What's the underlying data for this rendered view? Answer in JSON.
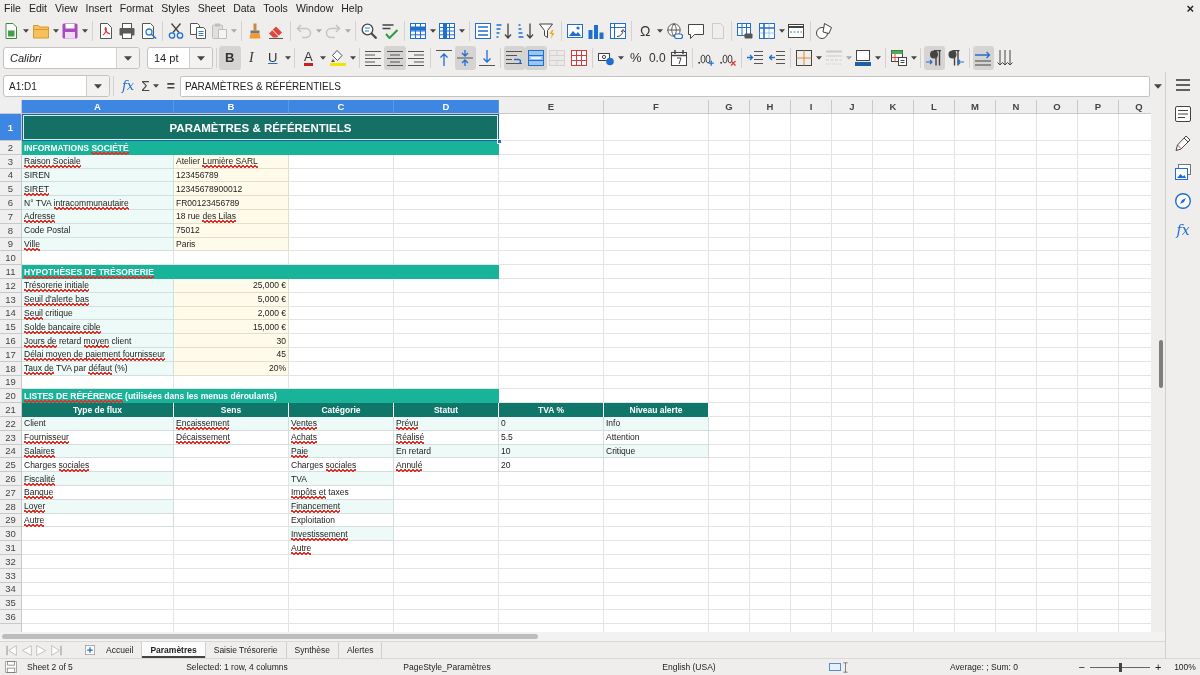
{
  "menu_bar": {
    "items": [
      "File",
      "Edit",
      "View",
      "Insert",
      "Format",
      "Styles",
      "Sheet",
      "Data",
      "Tools",
      "Window",
      "Help"
    ],
    "close_document": "×"
  },
  "standard_toolbar": [
    [
      {
        "dropdown": true,
        "disabled": false
      },
      {
        "dropdown": true,
        "disabled": false
      },
      {
        "dropdown": true,
        "disabled": false
      }
    ],
    [
      {
        "dropdown": false,
        "disabled": false
      },
      {
        "dropdown": false,
        "disabled": false
      },
      {
        "dropdown": false,
        "disabled": false
      }
    ],
    [
      {
        "dropdown": false,
        "disabled": false
      },
      {
        "dropdown": false,
        "disabled": false
      },
      {
        "dropdown": true,
        "disabled": true
      }
    ],
    [
      {
        "dropdown": false,
        "disabled": false
      },
      {
        "dropdown": false,
        "disabled": false
      }
    ],
    [
      {
        "dropdown": true,
        "disabled": true
      },
      {
        "dropdown": true,
        "disabled": true
      }
    ],
    [
      {
        "dropdown": false,
        "disabled": false
      },
      {
        "dropdown": false,
        "disabled": false
      }
    ],
    [
      {
        "dropdown": true,
        "disabled": false
      },
      {
        "dropdown": true,
        "disabled": false
      }
    ],
    [
      {
        "dropdown": false,
        "disabled": false
      },
      {
        "dropdown": false,
        "disabled": false
      },
      {
        "dropdown": false,
        "disabled": false
      },
      {
        "dropdown": false,
        "disabled": false
      }
    ],
    [
      {
        "dropdown": false,
        "disabled": false
      },
      {
        "dropdown": false,
        "disabled": false
      },
      {
        "dropdown": false,
        "disabled": false
      }
    ],
    [
      {
        "label": "Ω",
        "dropdown": true,
        "disabled": false
      },
      {
        "dropdown": false,
        "disabled": false
      },
      {
        "dropdown": false,
        "disabled": false
      },
      {
        "dropdown": false,
        "disabled": true
      }
    ],
    [
      {
        "dropdown": false,
        "disabled": false
      },
      {
        "dropdown": true,
        "disabled": false
      },
      {
        "dropdown": false,
        "disabled": false
      }
    ],
    [
      {
        "dropdown": false,
        "disabled": false
      }
    ]
  ],
  "formatting_toolbar": {
    "font_name": "Calibri",
    "font_size": "14 pt",
    "groups": [
      [
        {
          "label": "B",
          "on": true,
          "dropdown": false,
          "disabled": false
        },
        {
          "label": "I",
          "on": false,
          "dropdown": false,
          "disabled": false
        },
        {
          "label": "U",
          "on": false,
          "dropdown": true,
          "disabled": false
        }
      ],
      [
        {
          "label": "A",
          "on": false,
          "dropdown": true,
          "disabled": false
        },
        {
          "on": false,
          "dropdown": true,
          "disabled": false
        }
      ],
      [
        {
          "on": false,
          "dropdown": false,
          "disabled": false
        },
        {
          "on": true,
          "dropdown": false,
          "disabled": false
        },
        {
          "on": false,
          "dropdown": false,
          "disabled": false
        }
      ],
      [
        {
          "on": false,
          "dropdown": false,
          "disabled": false
        },
        {
          "on": true,
          "dropdown": false,
          "disabled": false
        },
        {
          "on": false,
          "dropdown": false,
          "disabled": false
        }
      ],
      [
        {
          "on": true,
          "dropdown": false,
          "disabled": false
        },
        {
          "on": true,
          "dropdown": false,
          "disabled": false
        },
        {
          "on": false,
          "dropdown": false,
          "disabled": true
        },
        {
          "on": false,
          "dropdown": false,
          "disabled": false
        }
      ],
      [
        {
          "on": false,
          "dropdown": true,
          "disabled": false
        },
        {
          "label": "%",
          "on": false,
          "dropdown": false,
          "disabled": false
        },
        {
          "label": "0.0",
          "on": false,
          "dropdown": false,
          "disabled": false
        },
        {
          "on": false,
          "dropdown": false,
          "disabled": false
        }
      ],
      [
        {
          "on": false,
          "dropdown": false,
          "disabled": false
        },
        {
          "on": false,
          "dropdown": false,
          "disabled": false
        }
      ],
      [
        {
          "on": false,
          "dropdown": false,
          "disabled": false
        },
        {
          "on": false,
          "dropdown": false,
          "disabled": false
        }
      ],
      [
        {
          "on": false,
          "dropdown": true,
          "disabled": false
        },
        {
          "on": false,
          "dropdown": true,
          "disabled": true
        },
        {
          "on": false,
          "dropdown": true,
          "disabled": false
        }
      ],
      [
        {
          "on": false,
          "dropdown": true,
          "disabled": false
        }
      ],
      [
        {
          "on": true,
          "dropdown": false,
          "disabled": false
        },
        {
          "on": false,
          "dropdown": false,
          "disabled": false
        }
      ],
      [
        {
          "on": true,
          "dropdown": false,
          "disabled": false
        },
        {
          "on": false,
          "dropdown": false,
          "disabled": false
        }
      ]
    ]
  },
  "formula_bar": {
    "name_box": "A1:D1",
    "function_wizard": "fx",
    "sum": "Σ",
    "formula": "=",
    "content": "PARAMÈTRES & RÉFÉRENTIELS"
  },
  "sheet": {
    "column_headers": [
      {
        "label": "A",
        "selected": true
      },
      {
        "label": "B",
        "selected": true
      },
      {
        "label": "C",
        "selected": true
      },
      {
        "label": "D",
        "selected": true
      },
      {
        "label": "E",
        "selected": false
      },
      {
        "label": "F",
        "selected": false
      },
      {
        "label": "G",
        "selected": false
      },
      {
        "label": "H",
        "selected": false
      },
      {
        "label": "I",
        "selected": false
      },
      {
        "label": "J",
        "selected": false
      },
      {
        "label": "K",
        "selected": false
      },
      {
        "label": "L",
        "selected": false
      },
      {
        "label": "M",
        "selected": false
      },
      {
        "label": "N",
        "selected": false
      },
      {
        "label": "O",
        "selected": false
      },
      {
        "label": "P",
        "selected": false
      },
      {
        "label": "Q",
        "selected": false
      }
    ],
    "row_headers": [
      {
        "label": "1",
        "selected": true
      },
      {
        "label": "2",
        "selected": false
      },
      {
        "label": "3",
        "selected": false
      },
      {
        "label": "4",
        "selected": false
      },
      {
        "label": "5",
        "selected": false
      },
      {
        "label": "6",
        "selected": false
      },
      {
        "label": "7",
        "selected": false
      },
      {
        "label": "8",
        "selected": false
      },
      {
        "label": "9",
        "selected": false
      },
      {
        "label": "10",
        "selected": false
      },
      {
        "label": "11",
        "selected": false
      },
      {
        "label": "12",
        "selected": false
      },
      {
        "label": "13",
        "selected": false
      },
      {
        "label": "14",
        "selected": false
      },
      {
        "label": "15",
        "selected": false
      },
      {
        "label": "16",
        "selected": false
      },
      {
        "label": "17",
        "selected": false
      },
      {
        "label": "18",
        "selected": false
      },
      {
        "label": "19",
        "selected": false
      },
      {
        "label": "20",
        "selected": false
      },
      {
        "label": "21",
        "selected": false
      },
      {
        "label": "22",
        "selected": false
      },
      {
        "label": "23",
        "selected": false
      },
      {
        "label": "24",
        "selected": false
      },
      {
        "label": "25",
        "selected": false
      },
      {
        "label": "26",
        "selected": false
      },
      {
        "label": "27",
        "selected": false
      },
      {
        "label": "28",
        "selected": false
      },
      {
        "label": "29",
        "selected": false
      },
      {
        "label": "30",
        "selected": false
      },
      {
        "label": "31",
        "selected": false
      },
      {
        "label": "32",
        "selected": false
      },
      {
        "label": "33",
        "selected": false
      },
      {
        "label": "34",
        "selected": false
      },
      {
        "label": "35",
        "selected": false
      },
      {
        "label": "36",
        "selected": false
      }
    ],
    "title": [
      {
        "text": "PARAMÈTRES & RÉFÉRENTIELS",
        "misspelled": false
      }
    ],
    "sections": [
      {
        "kind": "text_fields",
        "heading": [
          {
            "text": "INFORMATIONS",
            "misspelled": false
          },
          {
            "text": "SOCIÉTÉ",
            "misspelled": true
          }
        ],
        "rows": [
          {
            "label": [
              {
                "text": "Raison Sociale",
                "misspelled": true
              }
            ],
            "value": [
              {
                "text": "Atelier",
                "misspelled": false
              },
              {
                "text": "Lumière SARL",
                "misspelled": true
              }
            ]
          },
          {
            "label": [
              {
                "text": "SIREN",
                "misspelled": false
              }
            ],
            "value": [
              {
                "text": "123456789",
                "misspelled": false
              }
            ]
          },
          {
            "label": [
              {
                "text": "SIRET",
                "misspelled": true
              }
            ],
            "value": [
              {
                "text": "12345678900012",
                "misspelled": false
              }
            ]
          },
          {
            "label": [
              {
                "text": "N° TVA",
                "misspelled": false
              },
              {
                "text": "intracommunautaire",
                "misspelled": true
              }
            ],
            "value": [
              {
                "text": "FR00123456789",
                "misspelled": false
              }
            ]
          },
          {
            "label": [
              {
                "text": "Adresse",
                "misspelled": true
              }
            ],
            "value": [
              {
                "text": "18 rue",
                "misspelled": false
              },
              {
                "text": "des Lilas",
                "misspelled": true
              }
            ]
          },
          {
            "label": [
              {
                "text": "Code Postal",
                "misspelled": false
              }
            ],
            "value": [
              {
                "text": "75012",
                "misspelled": false
              }
            ]
          },
          {
            "label": [
              {
                "text": "Ville",
                "misspelled": true
              }
            ],
            "value": [
              {
                "text": "Paris",
                "misspelled": false
              }
            ]
          }
        ]
      },
      {
        "kind": "number_fields",
        "heading": [
          {
            "text": "HYPOTHÈSES DE TRÉSORERIE",
            "misspelled": true
          }
        ],
        "rows": [
          {
            "label": [
              {
                "text": "Trésorerie initiale",
                "misspelled": true
              }
            ],
            "value": [
              {
                "text": "25,000 €",
                "misspelled": false
              }
            ]
          },
          {
            "label": [
              {
                "text": "Seuil d'alerte bas",
                "misspelled": true
              }
            ],
            "value": [
              {
                "text": "5,000 €",
                "misspelled": false
              }
            ]
          },
          {
            "label": [
              {
                "text": "Seuil",
                "misspelled": true
              },
              {
                "text": "critique",
                "misspelled": false
              }
            ],
            "value": [
              {
                "text": "2,000 €",
                "misspelled": false
              }
            ]
          },
          {
            "label": [
              {
                "text": "Solde bancaire cible",
                "misspelled": true
              }
            ],
            "value": [
              {
                "text": "15,000 €",
                "misspelled": false
              }
            ]
          },
          {
            "label": [
              {
                "text": "Jours de",
                "misspelled": true
              },
              {
                "text": "retard",
                "misspelled": false
              },
              {
                "text": "moyen",
                "misspelled": true
              },
              {
                "text": "client",
                "misspelled": false
              }
            ],
            "value": [
              {
                "text": "30",
                "misspelled": false
              }
            ]
          },
          {
            "label": [
              {
                "text": "Délai moyen de paiement fournisseur",
                "misspelled": true
              }
            ],
            "value": [
              {
                "text": "45",
                "misspelled": false
              }
            ]
          },
          {
            "label": [
              {
                "text": "Taux de",
                "misspelled": true
              },
              {
                "text": "TVA par",
                "misspelled": false
              },
              {
                "text": "défaut",
                "misspelled": true
              },
              {
                "text": "(%)",
                "misspelled": false
              }
            ],
            "value": [
              {
                "text": "20%",
                "misspelled": false
              }
            ]
          }
        ]
      },
      {
        "kind": "lists",
        "heading": [
          {
            "text": "LISTES DE RÉFÉRENCE",
            "misspelled": true
          },
          {
            "text": "(utilisées dans les menus déroulants)",
            "misspelled": false
          }
        ],
        "columns": [
          {
            "header": "Type de flux",
            "items": [
              [
                {
                  "text": "Client",
                  "misspelled": false
                }
              ],
              [
                {
                  "text": "Fournisseur",
                  "misspelled": true
                }
              ],
              [
                {
                  "text": "Salaires",
                  "misspelled": true
                }
              ],
              [
                {
                  "text": "Charges",
                  "misspelled": false
                },
                {
                  "text": "sociales",
                  "misspelled": true
                }
              ],
              [
                {
                  "text": "Fiscalité",
                  "misspelled": true
                }
              ],
              [
                {
                  "text": "Banque",
                  "misspelled": true
                }
              ],
              [
                {
                  "text": "Loyer",
                  "misspelled": true
                }
              ],
              [
                {
                  "text": "Autre",
                  "misspelled": true
                }
              ]
            ]
          },
          {
            "header": "Sens",
            "items": [
              [
                {
                  "text": "Encaissement",
                  "misspelled": true
                }
              ],
              [
                {
                  "text": "Décaissement",
                  "misspelled": true
                }
              ]
            ]
          },
          {
            "header": "Catégorie",
            "items": [
              [
                {
                  "text": "Ventes",
                  "misspelled": true
                }
              ],
              [
                {
                  "text": "Achats",
                  "misspelled": true
                }
              ],
              [
                {
                  "text": "Paie",
                  "misspelled": true
                }
              ],
              [
                {
                  "text": "Charges",
                  "misspelled": false
                },
                {
                  "text": "sociales",
                  "misspelled": true
                }
              ],
              [
                {
                  "text": "TVA",
                  "misspelled": false
                }
              ],
              [
                {
                  "text": "Impôts et",
                  "misspelled": true
                },
                {
                  "text": "taxes",
                  "misspelled": false
                }
              ],
              [
                {
                  "text": "Financement",
                  "misspelled": true
                }
              ],
              [
                {
                  "text": "Exploitation",
                  "misspelled": false
                }
              ],
              [
                {
                  "text": "Investissement",
                  "misspelled": true
                }
              ],
              [
                {
                  "text": "Autre",
                  "misspelled": true
                }
              ]
            ]
          },
          {
            "header": "Statut",
            "items": [
              [
                {
                  "text": "Prévu",
                  "misspelled": true
                }
              ],
              [
                {
                  "text": "Réalisé",
                  "misspelled": true
                }
              ],
              [
                {
                  "text": "En retard",
                  "misspelled": false
                }
              ],
              [
                {
                  "text": "Annulé",
                  "misspelled": true
                }
              ]
            ]
          },
          {
            "header": "TVA %",
            "items": [
              [
                {
                  "text": "0",
                  "misspelled": false
                }
              ],
              [
                {
                  "text": "5.5",
                  "misspelled": false
                }
              ],
              [
                {
                  "text": "10",
                  "misspelled": false
                }
              ],
              [
                {
                  "text": "20",
                  "misspelled": false
                }
              ]
            ]
          },
          {
            "header": "Niveau alerte",
            "items": [
              [
                {
                  "text": "Info",
                  "misspelled": false
                }
              ],
              [
                {
                  "text": "Attention",
                  "misspelled": false
                }
              ],
              [
                {
                  "text": "Critique",
                  "misspelled": false
                }
              ]
            ]
          }
        ]
      }
    ]
  },
  "sheet_tabs": {
    "tabs": [
      {
        "label": "Accueil",
        "selected": false
      },
      {
        "label": "Paramètres",
        "selected": true
      },
      {
        "label": "Saisie Trésorerie",
        "selected": false
      },
      {
        "label": "Synthèse",
        "selected": false
      },
      {
        "label": "Alertes",
        "selected": false
      }
    ]
  },
  "sidebar": {
    "functions_label": "fx"
  },
  "status_bar": {
    "sheet_position": "Sheet 2 of 5",
    "selection": "Selected: 1 row, 4 columns",
    "page_style": "PageStyle_Paramètres",
    "language": "English (USA)",
    "summary": "Average: ; Sum: 0",
    "zoom_out": "−",
    "zoom_slider": {
      "level": 0.5
    },
    "zoom_in": "+",
    "zoom_level": "100%"
  }
}
